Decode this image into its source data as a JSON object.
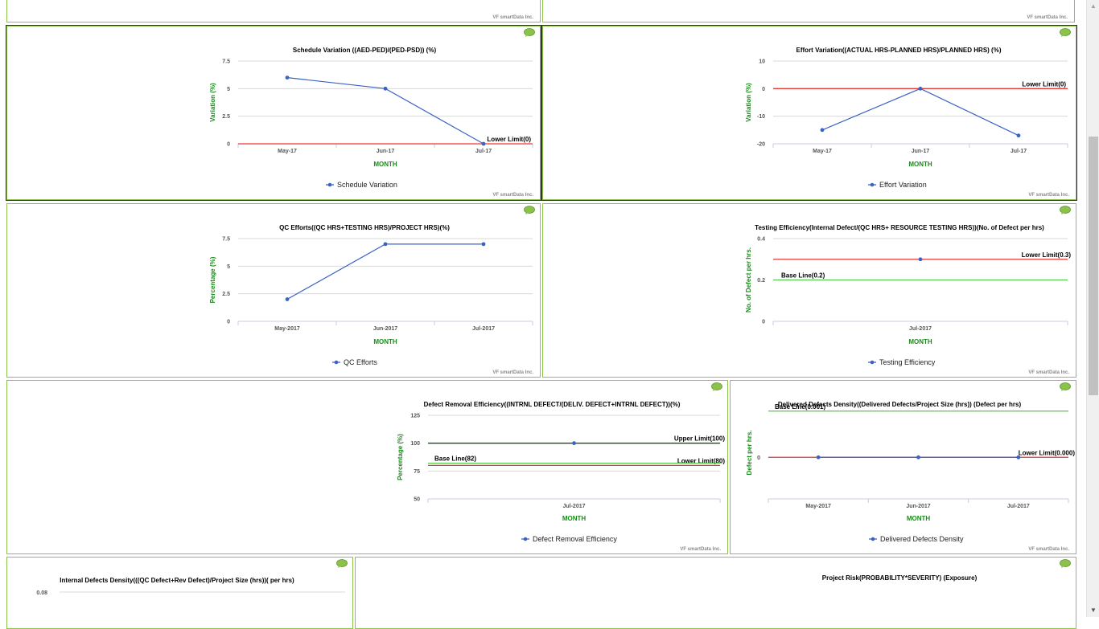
{
  "credit": "VF smartData Inc.",
  "colors": {
    "series": "#3a63c4",
    "lower": "#e53935",
    "base": "#57c84d",
    "upper": "#1f4a1f",
    "grid": "#d8d8d8",
    "panel_border": "#8bc34a",
    "axis_title": "#1a8a1a"
  },
  "icons": {
    "comment": "comment-bubble-icon"
  },
  "charts": {
    "schedule": {
      "type": "line",
      "title": "Schedule Variation ((AED-PED)/(PED-PSD)) (%)",
      "xlabel": "MONTH",
      "ylabel": "Variation (%)",
      "categories": [
        "May-17",
        "Jun-17",
        "Jul-17"
      ],
      "ylim": [
        0,
        7.5
      ],
      "yticks": [
        0,
        2.5,
        5,
        7.5
      ],
      "ytick_labels": [
        "0",
        "2.5",
        "5",
        "7.5"
      ],
      "series": [
        {
          "name": "Schedule Variation",
          "values": [
            6,
            5,
            0
          ]
        }
      ],
      "lines": [
        {
          "label": "Lower Limit(0)",
          "value": 0,
          "kind": "lower"
        }
      ],
      "legend": "bottom-center"
    },
    "effort": {
      "type": "line",
      "title": "Effort Variation((ACTUAL HRS-PLANNED HRS)/PLANNED HRS) (%)",
      "xlabel": "MONTH",
      "ylabel": "Variation (%)",
      "categories": [
        "May-17",
        "Jun-17",
        "Jul-17"
      ],
      "ylim": [
        -20,
        10
      ],
      "yticks": [
        -20,
        -10,
        0,
        10
      ],
      "ytick_labels": [
        "-20",
        "-10",
        "0",
        "10"
      ],
      "series": [
        {
          "name": "Effort Variation",
          "values": [
            -15,
            0,
            -17
          ]
        }
      ],
      "lines": [
        {
          "label": "Lower Limit(0)",
          "value": 0,
          "kind": "lower"
        }
      ],
      "legend": "bottom-center"
    },
    "qc": {
      "type": "line",
      "title": "QC Efforts((QC HRS+TESTING HRS)/PROJECT HRS)(%)",
      "xlabel": "MONTH",
      "ylabel": "Percentage (%)",
      "categories": [
        "May-2017",
        "Jun-2017",
        "Jul-2017"
      ],
      "ylim": [
        0,
        7.5
      ],
      "yticks": [
        0,
        2.5,
        5,
        7.5
      ],
      "ytick_labels": [
        "0",
        "2.5",
        "5",
        "7.5"
      ],
      "series": [
        {
          "name": "QC Efforts",
          "values": [
            2,
            7,
            7
          ]
        }
      ],
      "lines": [],
      "legend": "bottom-center"
    },
    "testing": {
      "type": "line",
      "title": "Testing Efficiency(Internal Defect/(QC HRS+ RESOURCE TESTING HRS))(No. of Defect per hrs)",
      "xlabel": "MONTH",
      "ylabel": "No. of Defect per hrs.",
      "categories": [
        "Jul-2017"
      ],
      "ylim": [
        0,
        0.4
      ],
      "yticks": [
        0,
        0.2,
        0.4
      ],
      "ytick_labels": [
        "0",
        "0.2",
        "0.4"
      ],
      "series": [
        {
          "name": "Testing Efficiency",
          "values": [
            0.3
          ]
        }
      ],
      "lines": [
        {
          "label": "Lower Limit(0.3)",
          "value": 0.3,
          "kind": "lower"
        },
        {
          "label": "Base Line(0.2)",
          "value": 0.2,
          "kind": "base"
        }
      ],
      "legend": "bottom-center"
    },
    "dre": {
      "type": "line",
      "title": "Defect Removal Efficiency((INTRNL DEFECT/(DELIV. DEFECT+INTRNL DEFECT))(%)",
      "xlabel": "MONTH",
      "ylabel": "Percentage (%)",
      "categories": [
        "Jul-2017"
      ],
      "ylim": [
        50,
        125
      ],
      "yticks": [
        50,
        75,
        100,
        125
      ],
      "ytick_labels": [
        "50",
        "75",
        "100",
        "125"
      ],
      "series": [
        {
          "name": "Defect Removal Efficiency",
          "values": [
            100
          ]
        }
      ],
      "lines": [
        {
          "label": "Upper Limit(100)",
          "value": 100,
          "kind": "upper"
        },
        {
          "label": "Lower Limit(80)",
          "value": 80,
          "kind": "lower"
        },
        {
          "label": "Base Line(82)",
          "value": 82,
          "kind": "base"
        }
      ],
      "legend": "bottom-center"
    },
    "ddd": {
      "type": "line",
      "title": "Delivered Defects Density((Delivered Defects/Project Size (hrs)) (Defect per hrs)",
      "xlabel": "MONTH",
      "ylabel": "Defect per hrs.",
      "categories": [
        "May-2017",
        "Jun-2017",
        "Jul-2017"
      ],
      "ylim": [
        -0.0009,
        0.0011
      ],
      "yticks": [
        0
      ],
      "ytick_labels": [
        "0"
      ],
      "series": [
        {
          "name": "Delivered Defects Density",
          "values": [
            0,
            0,
            0
          ]
        }
      ],
      "lines": [
        {
          "label": "Lower Limit(0.000)",
          "value": 0,
          "kind": "lower"
        },
        {
          "label": "Base Line(0.001)",
          "value": 0.001,
          "kind": "base"
        }
      ],
      "legend": "bottom-center"
    },
    "idd": {
      "type": "line",
      "title": "Internal Defects Density(((QC Defect+Rev Defect)/Project Size (hrs))( per hrs)",
      "yticks": [
        0.08
      ],
      "ytick_labels": [
        "0.08"
      ]
    },
    "risk": {
      "type": "line",
      "title": "Project Risk(PROBABILITY*SEVERITY) (Exposure)"
    }
  }
}
